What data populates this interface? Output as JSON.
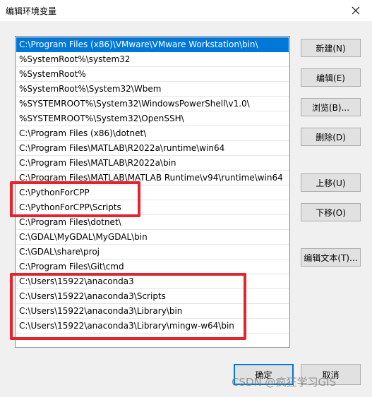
{
  "window": {
    "title": "编辑环境变量",
    "close_icon": "close-icon"
  },
  "path_list": {
    "items": [
      "C:\\Program Files (x86)\\VMware\\VMware Workstation\\bin\\",
      "%SystemRoot%\\system32",
      "%SystemRoot%",
      "%SystemRoot%\\System32\\Wbem",
      "%SYSTEMROOT%\\System32\\WindowsPowerShell\\v1.0\\",
      "%SYSTEMROOT%\\System32\\OpenSSH\\",
      "C:\\Program Files (x86)\\dotnet\\",
      "C:\\Program Files\\MATLAB\\R2022a\\runtime\\win64",
      "C:\\Program Files\\MATLAB\\R2022a\\bin",
      "C:\\Program Files\\MATLAB\\MATLAB Runtime\\v94\\runtime\\win64",
      "C:\\PythonForCPP",
      "C:\\PythonForCPP\\Scripts",
      "C:\\Program Files\\dotnet\\",
      "C:\\GDAL\\MyGDAL\\MyGDAL\\bin",
      "C:\\GDAL\\share\\proj",
      "C:\\Program Files\\Git\\cmd",
      "C:\\Users\\15922\\anaconda3",
      "C:\\Users\\15922\\anaconda3\\Scripts",
      "C:\\Users\\15922\\anaconda3\\Library\\bin",
      "C:\\Users\\15922\\anaconda3\\Library\\mingw-w64\\bin"
    ],
    "selected_index": 0
  },
  "buttons": {
    "new": "新建(N)",
    "edit": "编辑(E)",
    "browse": "浏览(B)...",
    "delete": "删除(D)",
    "move_up": "上移(U)",
    "move_down": "下移(O)",
    "edit_text": "编辑文本(T)...",
    "ok": "确定",
    "cancel": "取消"
  },
  "highlight_color": "#e3232e",
  "selection_color": "#0078d7",
  "watermark": "CSDN @疯狂学习GIS"
}
